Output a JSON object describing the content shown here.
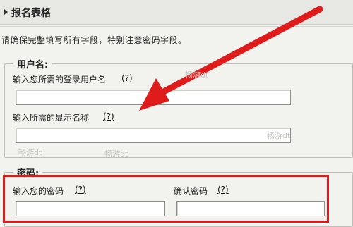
{
  "header": {
    "title": "报名表格"
  },
  "notice": "请确保完整填写所有字段，特别注意密码字段。",
  "user_section": {
    "legend": "用户名:",
    "login_label": "输入您所需的登录用户名",
    "display_label": "输入所需的显示名称",
    "help_text": "(?)"
  },
  "password_section": {
    "legend": "密码:",
    "password_label": "输入您的密码",
    "confirm_label": "确认密码",
    "help_text": "(?)"
  },
  "watermark": "畅游dt",
  "colors": {
    "highlight": "#e01b1b"
  }
}
